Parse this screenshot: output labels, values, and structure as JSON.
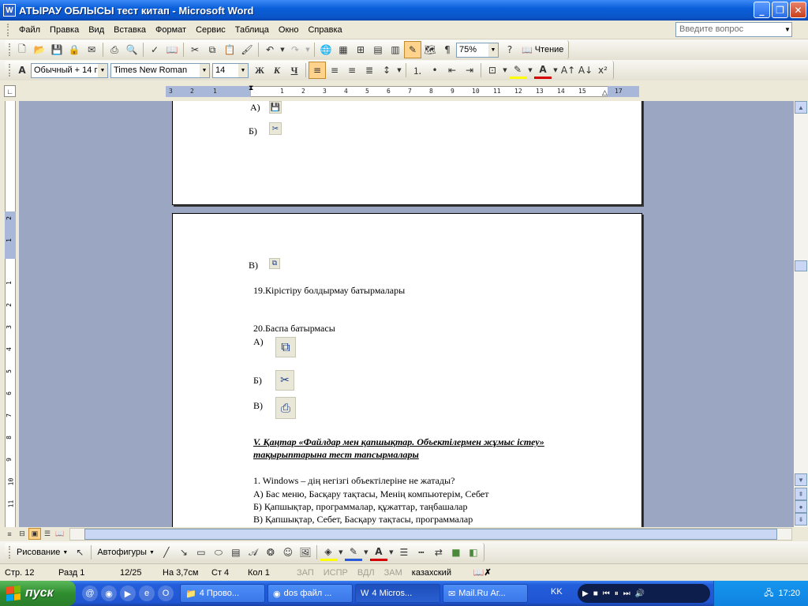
{
  "window": {
    "title": "АТЫРАУ ОБЛЫСЫ тест китап - Microsoft Word"
  },
  "menu": [
    "Файл",
    "Правка",
    "Вид",
    "Вставка",
    "Формат",
    "Сервис",
    "Таблица",
    "Окно",
    "Справка"
  ],
  "help": {
    "placeholder": "Введите вопрос"
  },
  "toolbar": {
    "zoom": "75%",
    "reading_label": "Чтение"
  },
  "formatting": {
    "style": "Обычный + 14 г",
    "font": "Times New Roman",
    "size": "14",
    "bold": "Ж",
    "italic": "К",
    "underline": "Ч"
  },
  "ruler": {
    "h_ticks": [
      "3",
      "2",
      "1",
      "1",
      "2",
      "3",
      "4",
      "5",
      "6",
      "7",
      "8",
      "9",
      "10",
      "11",
      "12",
      "13",
      "14",
      "15",
      "16",
      "17"
    ],
    "v_ticks": [
      "2",
      "1",
      "1",
      "1",
      "2",
      "3",
      "4",
      "5",
      "6",
      "7",
      "8",
      "9",
      "10",
      "11",
      "12"
    ]
  },
  "document": {
    "page1": {
      "a_label": "А)",
      "b_label": "Б)"
    },
    "page2": {
      "v_label": "В)",
      "q19": "19.Кірістіру болдырмау батырмалары",
      "q20": "20.Баспа батырмасы",
      "a_label": "А)",
      "b_label": "Б)",
      "v2_label": "В)",
      "heading_line1": "V. Қаңтар «Файлдар мен қапшықтар. Объектілермен жұмыс істеу»",
      "heading_line2": "тақырыптарына тест тапсырмалары",
      "q1": "1.  Windows – дің негізгі  объектілеріне не жатады?",
      "q1a": "А) Бас меню, Басқару тақтасы, Менің компьютерім, Себет",
      "q1b": "Б) Қапшықтар, программалар, құжаттар, таңбашалар",
      "q1c": "В) Қапшықтар, Себет, Басқару тақтасы, программалар"
    }
  },
  "drawing": {
    "draw_label": "Рисование",
    "autoshapes_label": "Автофигуры"
  },
  "status": {
    "page": "Стр. 12",
    "section": "Разд 1",
    "pages": "12/25",
    "at": "На 3,7см",
    "line": "Ст 4",
    "col": "Кол 1",
    "rec": "ЗАП",
    "trk": "ИСПР",
    "ext": "ВДЛ",
    "ovr": "ЗАМ",
    "lang": "казахский"
  },
  "taskbar": {
    "start": "пуск",
    "tasks": [
      "4 Прово...",
      "dos файл ...",
      "4 Micros...",
      "Mail.Ru Аг..."
    ],
    "lang": "KK",
    "clock": "17:20"
  }
}
